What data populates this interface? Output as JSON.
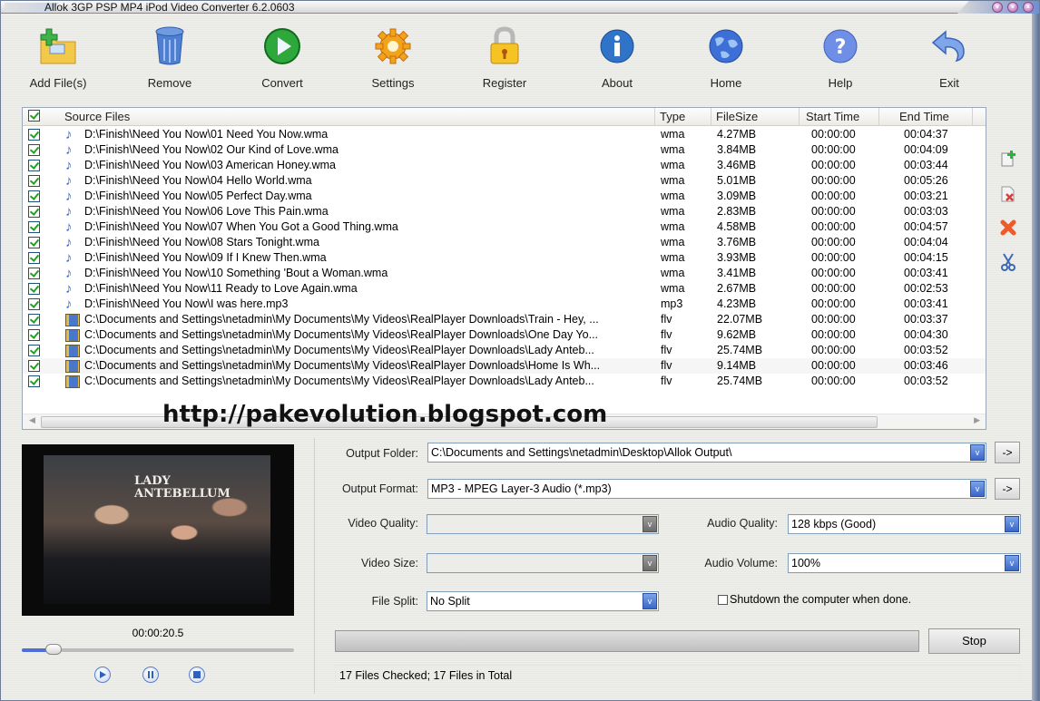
{
  "window": {
    "title": "Allok 3GP PSP MP4 iPod Video Converter 6.2.0603",
    "controls": [
      "minimize",
      "maximize",
      "close"
    ]
  },
  "toolbar": [
    {
      "label": "Add File(s)",
      "icon": "add-folder-icon"
    },
    {
      "label": "Remove",
      "icon": "trash-icon"
    },
    {
      "label": "Convert",
      "icon": "play-icon"
    },
    {
      "label": "Settings",
      "icon": "gear-icon"
    },
    {
      "label": "Register",
      "icon": "lock-icon"
    },
    {
      "label": "About",
      "icon": "info-icon"
    },
    {
      "label": "Home",
      "icon": "globe-icon"
    },
    {
      "label": "Help",
      "icon": "help-icon"
    },
    {
      "label": "Exit",
      "icon": "exit-arrow-icon"
    }
  ],
  "filelist": {
    "columns": [
      "Source Files",
      "Type",
      "FileSize",
      "Start Time",
      "End Time"
    ],
    "rows": [
      {
        "path": "D:\\Finish\\Need You Now\\01 Need You Now.wma",
        "type": "wma",
        "size": "4.27MB",
        "start": "00:00:00",
        "end": "00:04:37",
        "kind": "audio"
      },
      {
        "path": "D:\\Finish\\Need You Now\\02 Our Kind of Love.wma",
        "type": "wma",
        "size": "3.84MB",
        "start": "00:00:00",
        "end": "00:04:09",
        "kind": "audio"
      },
      {
        "path": "D:\\Finish\\Need You Now\\03 American Honey.wma",
        "type": "wma",
        "size": "3.46MB",
        "start": "00:00:00",
        "end": "00:03:44",
        "kind": "audio"
      },
      {
        "path": "D:\\Finish\\Need You Now\\04 Hello World.wma",
        "type": "wma",
        "size": "5.01MB",
        "start": "00:00:00",
        "end": "00:05:26",
        "kind": "audio"
      },
      {
        "path": "D:\\Finish\\Need You Now\\05 Perfect Day.wma",
        "type": "wma",
        "size": "3.09MB",
        "start": "00:00:00",
        "end": "00:03:21",
        "kind": "audio"
      },
      {
        "path": "D:\\Finish\\Need You Now\\06 Love This Pain.wma",
        "type": "wma",
        "size": "2.83MB",
        "start": "00:00:00",
        "end": "00:03:03",
        "kind": "audio"
      },
      {
        "path": "D:\\Finish\\Need You Now\\07 When You Got a Good Thing.wma",
        "type": "wma",
        "size": "4.58MB",
        "start": "00:00:00",
        "end": "00:04:57",
        "kind": "audio"
      },
      {
        "path": "D:\\Finish\\Need You Now\\08 Stars Tonight.wma",
        "type": "wma",
        "size": "3.76MB",
        "start": "00:00:00",
        "end": "00:04:04",
        "kind": "audio"
      },
      {
        "path": "D:\\Finish\\Need You Now\\09 If I Knew Then.wma",
        "type": "wma",
        "size": "3.93MB",
        "start": "00:00:00",
        "end": "00:04:15",
        "kind": "audio"
      },
      {
        "path": "D:\\Finish\\Need You Now\\10 Something 'Bout a Woman.wma",
        "type": "wma",
        "size": "3.41MB",
        "start": "00:00:00",
        "end": "00:03:41",
        "kind": "audio"
      },
      {
        "path": "D:\\Finish\\Need You Now\\11 Ready to Love Again.wma",
        "type": "wma",
        "size": "2.67MB",
        "start": "00:00:00",
        "end": "00:02:53",
        "kind": "audio"
      },
      {
        "path": "D:\\Finish\\Need You Now\\I was here.mp3",
        "type": "mp3",
        "size": "4.23MB",
        "start": "00:00:00",
        "end": "00:03:41",
        "kind": "audio"
      },
      {
        "path": "C:\\Documents and Settings\\netadmin\\My Documents\\My Videos\\RealPlayer Downloads\\Train - Hey, ...",
        "type": "flv",
        "size": "22.07MB",
        "start": "00:00:00",
        "end": "00:03:37",
        "kind": "video"
      },
      {
        "path": "C:\\Documents and Settings\\netadmin\\My Documents\\My Videos\\RealPlayer Downloads\\One Day Yo...",
        "type": "flv",
        "size": "9.62MB",
        "start": "00:00:00",
        "end": "00:04:30",
        "kind": "video"
      },
      {
        "path": "C:\\Documents and Settings\\netadmin\\My Documents\\My Videos\\RealPlayer Downloads\\Lady Anteb...",
        "type": "flv",
        "size": "25.74MB",
        "start": "00:00:00",
        "end": "00:03:52",
        "kind": "video"
      },
      {
        "path": "C:\\Documents and Settings\\netadmin\\My Documents\\My Videos\\RealPlayer Downloads\\Home Is Wh...",
        "type": "flv",
        "size": "9.14MB",
        "start": "00:00:00",
        "end": "00:03:46",
        "kind": "video"
      },
      {
        "path": "C:\\Documents and Settings\\netadmin\\My Documents\\My Videos\\RealPlayer Downloads\\Lady Anteb...",
        "type": "flv",
        "size": "25.74MB",
        "start": "00:00:00",
        "end": "00:03:52",
        "kind": "video"
      }
    ]
  },
  "side_buttons": [
    "add-file-icon",
    "remove-file-icon",
    "clear-all-icon",
    "cut-scissors-icon"
  ],
  "watermark": "http://pakevolution.blogspot.com",
  "preview": {
    "art_text_line1": "LADY",
    "art_text_line2": "ANTEBELLUM",
    "time": "00:00:20.5",
    "seek_progress": 0.1
  },
  "settings": {
    "output_folder_label": "Output Folder:",
    "output_folder_value": "C:\\Documents and Settings\\netadmin\\Desktop\\Allok Output\\",
    "output_format_label": "Output Format:",
    "output_format_value": "MP3 - MPEG Layer-3 Audio (*.mp3)",
    "video_quality_label": "Video Quality:",
    "video_quality_value": "",
    "video_size_label": "Video Size:",
    "video_size_value": "",
    "file_split_label": "File Split:",
    "file_split_value": "No Split",
    "audio_quality_label": "Audio Quality:",
    "audio_quality_value": "128 kbps (Good)",
    "audio_volume_label": "Audio Volume:",
    "audio_volume_value": "100%",
    "shutdown_label": "Shutdown the computer when done.",
    "shutdown_checked": false,
    "arrow_button": "->",
    "dropdown_glyph": "v"
  },
  "progress": {
    "value": 0
  },
  "stop_label": "Stop",
  "status": "17 Files Checked; 17 Files in Total"
}
